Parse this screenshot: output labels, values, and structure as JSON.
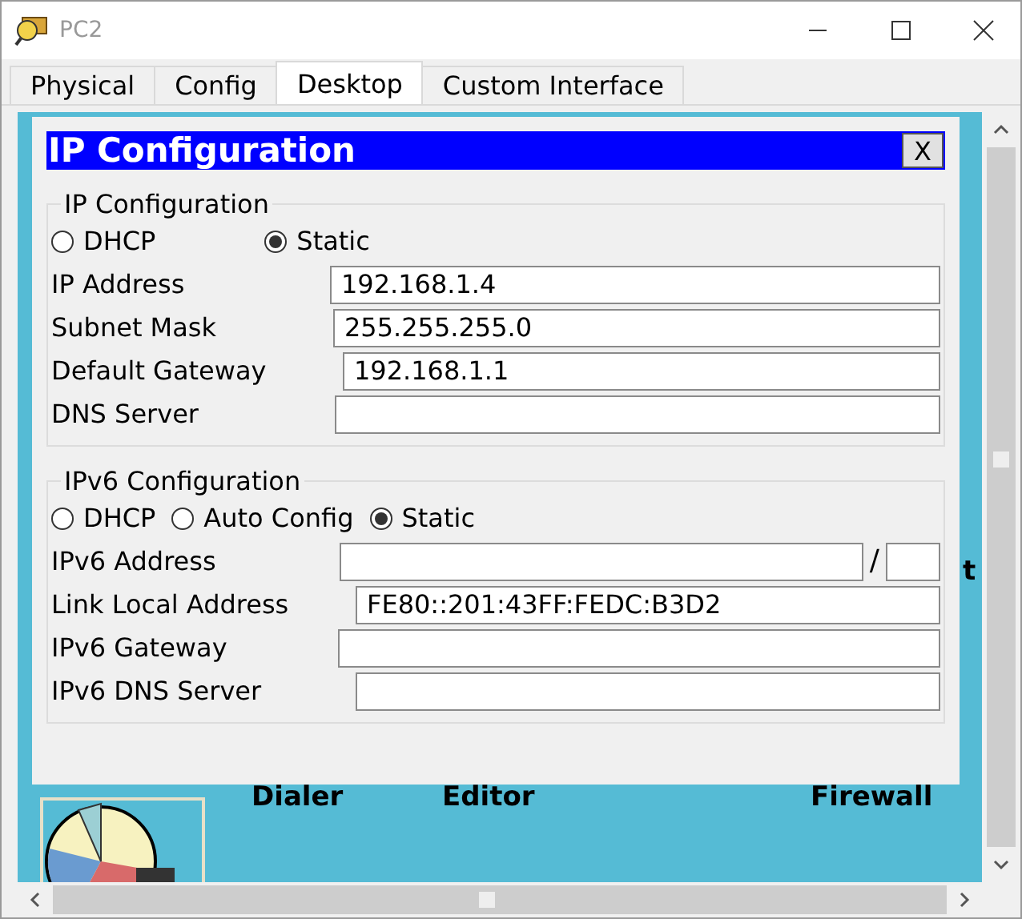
{
  "window": {
    "title": "PC2"
  },
  "tabs": [
    {
      "label": "Physical",
      "selected": false
    },
    {
      "label": "Config",
      "selected": false
    },
    {
      "label": "Desktop",
      "selected": true
    },
    {
      "label": "Custom Interface",
      "selected": false
    }
  ],
  "desktop": {
    "labels": [
      "Dialer",
      "Editor",
      "Firewall"
    ],
    "edge_text": "t"
  },
  "dialog": {
    "title": "IP Configuration",
    "close": "X",
    "ipv4": {
      "legend": "IP Configuration",
      "modes": [
        {
          "label": "DHCP",
          "selected": false
        },
        {
          "label": "Static",
          "selected": true
        }
      ],
      "fields": [
        {
          "kind": "plain",
          "label": "IP Address",
          "value": "192.168.1.4"
        },
        {
          "kind": "plain",
          "label": "Subnet Mask",
          "value": "255.255.255.0"
        },
        {
          "kind": "plain",
          "label": "Default Gateway",
          "value": "192.168.1.1"
        },
        {
          "kind": "plain",
          "label": "DNS Server"
        }
      ]
    },
    "ipv6": {
      "legend": "IPv6 Configuration",
      "modes": [
        {
          "label": "DHCP",
          "selected": false
        },
        {
          "label": "Auto Config",
          "selected": false
        },
        {
          "label": "Static",
          "selected": true
        }
      ],
      "fields": [
        {
          "kind": "prefix",
          "label": "IPv6 Address",
          "separator": "/"
        },
        {
          "kind": "plain",
          "label": "Link Local Address",
          "value": "FE80::201:43FF:FEDC:B3D2"
        },
        {
          "kind": "plain",
          "label": "IPv6 Gateway"
        },
        {
          "kind": "plain",
          "label": "IPv6 DNS Server"
        }
      ]
    }
  }
}
